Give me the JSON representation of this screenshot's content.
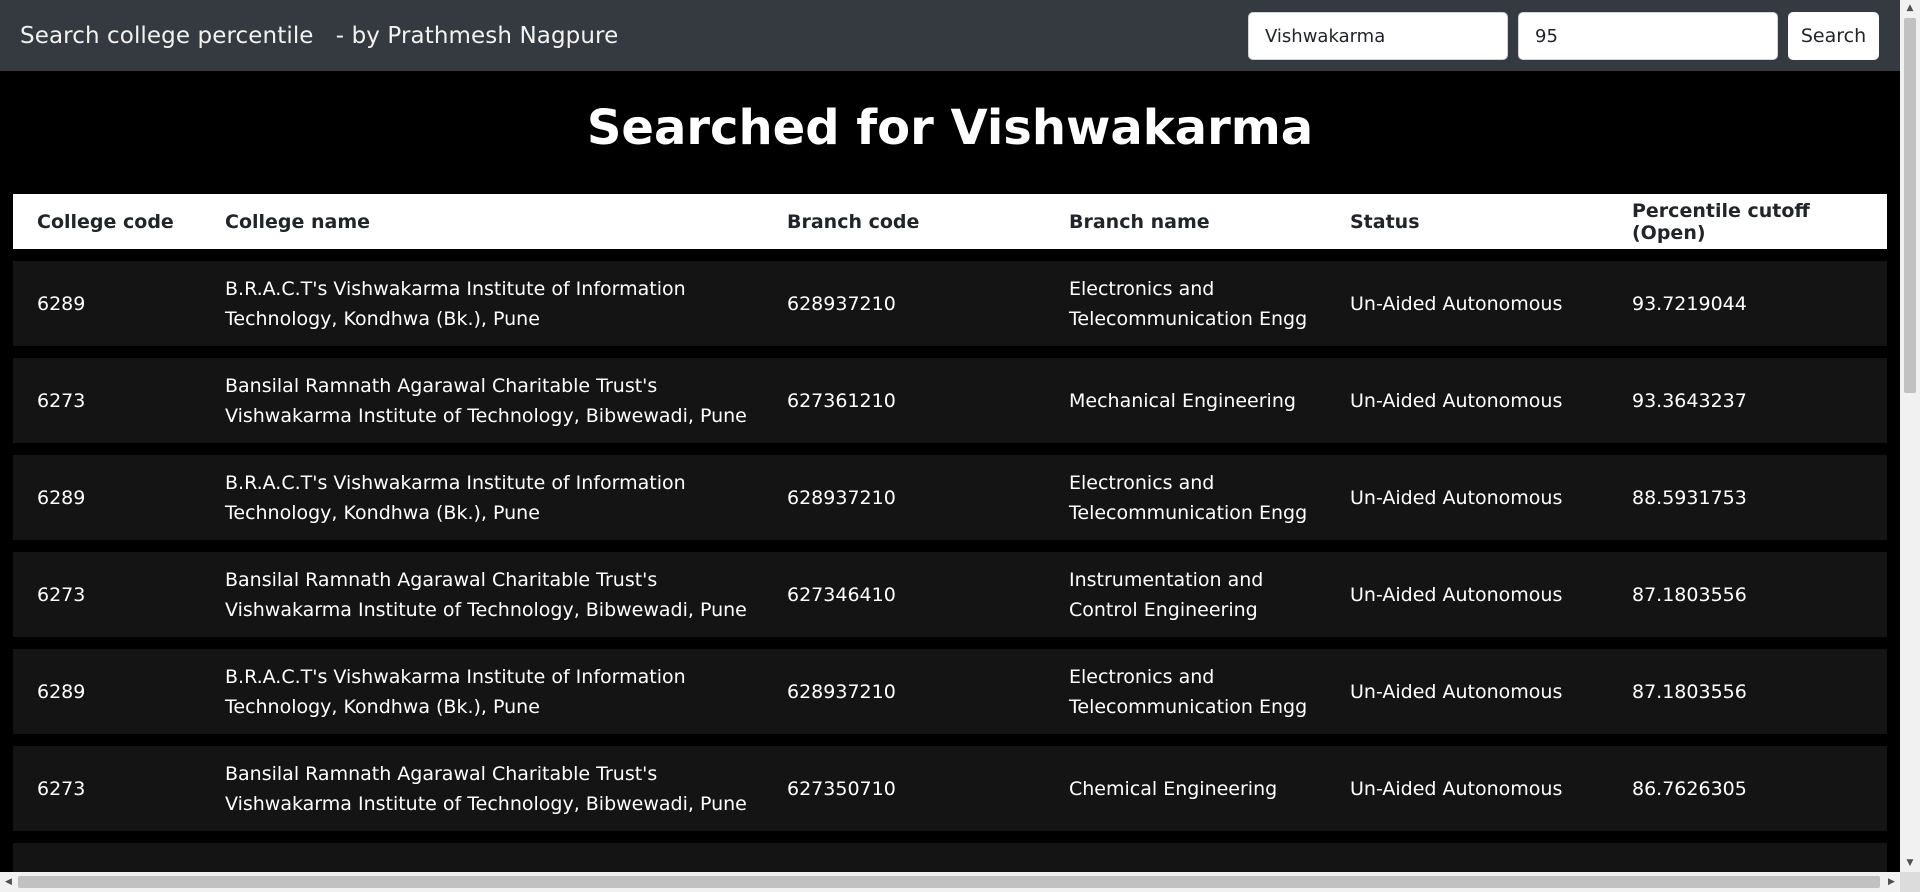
{
  "navbar": {
    "brand": "Search college percentile   - by Prathmesh Nagpure",
    "search_value": "Vishwakarma",
    "percentile_value": "95",
    "search_button": "Search"
  },
  "heading": "Searched for Vishwakarma",
  "table": {
    "headers": [
      "College code",
      "College name",
      "Branch code",
      "Branch name",
      "Status",
      "Percentile cutoff (Open)"
    ],
    "rows": [
      [
        "6289",
        "B.R.A.C.T's Vishwakarma Institute of Information Technology, Kondhwa (Bk.), Pune",
        "628937210",
        "Electronics and Telecommunication Engg",
        "Un-Aided Autonomous",
        "93.7219044"
      ],
      [
        "6273",
        "Bansilal Ramnath Agarawal Charitable Trust's Vishwakarma Institute of Technology, Bibwewadi, Pune",
        "627361210",
        "Mechanical Engineering",
        "Un-Aided Autonomous",
        "93.3643237"
      ],
      [
        "6289",
        "B.R.A.C.T's Vishwakarma Institute of Information Technology, Kondhwa (Bk.), Pune",
        "628937210",
        "Electronics and Telecommunication Engg",
        "Un-Aided Autonomous",
        "88.5931753"
      ],
      [
        "6273",
        "Bansilal Ramnath Agarawal Charitable Trust's Vishwakarma Institute of Technology, Bibwewadi, Pune",
        "627346410",
        "Instrumentation and Control Engineering",
        "Un-Aided Autonomous",
        "87.1803556"
      ],
      [
        "6289",
        "B.R.A.C.T's Vishwakarma Institute of Information Technology, Kondhwa (Bk.), Pune",
        "628937210",
        "Electronics and Telecommunication Engg",
        "Un-Aided Autonomous",
        "87.1803556"
      ],
      [
        "6273",
        "Bansilal Ramnath Agarawal Charitable Trust's Vishwakarma Institute of Technology, Bibwewadi, Pune",
        "627350710",
        "Chemical Engineering",
        "Un-Aided Autonomous",
        "86.7626305"
      ]
    ]
  },
  "scrollbars": {
    "up_arrow_icon": "triangle-up-icon",
    "down_arrow_icon": "triangle-down-icon",
    "left_arrow_icon": "triangle-left-icon",
    "right_arrow_icon": "triangle-right-icon"
  }
}
